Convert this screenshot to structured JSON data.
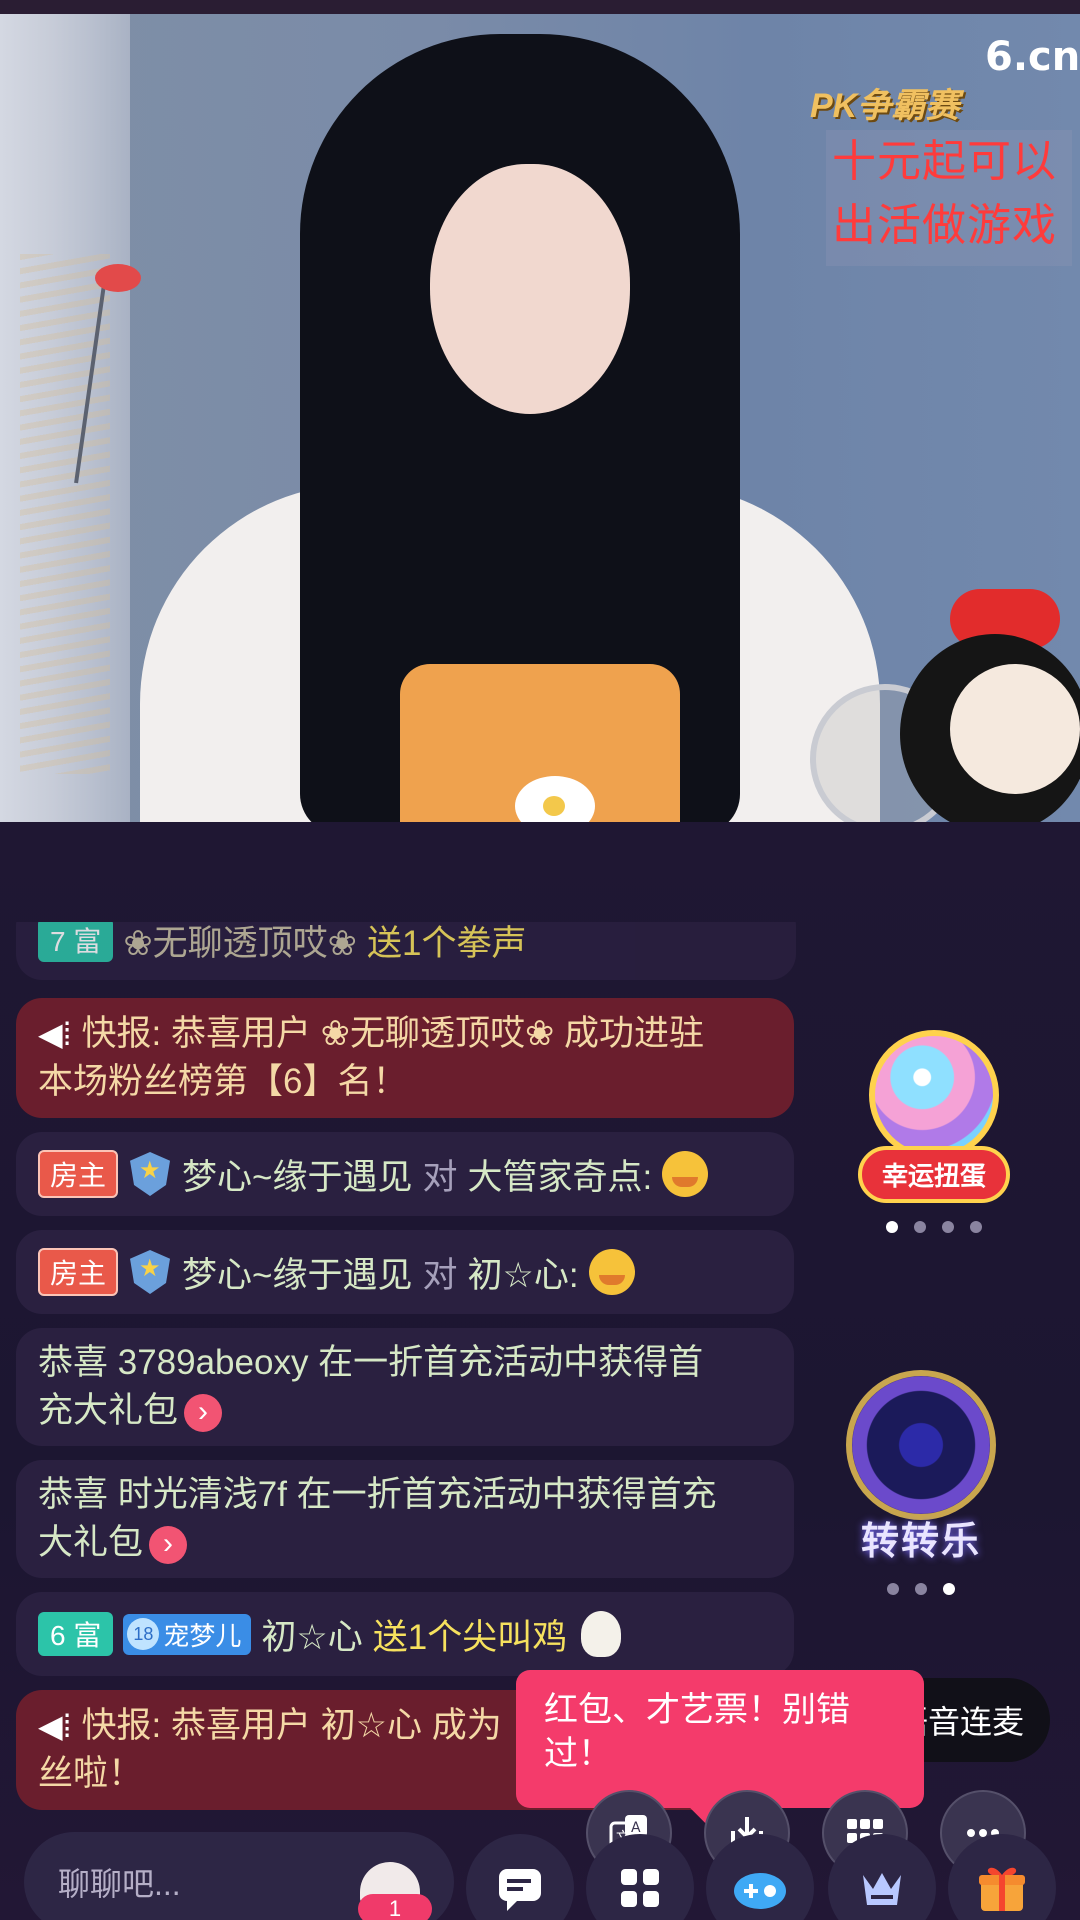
{
  "video": {
    "site_logo": "6.cn",
    "event_banner": "PK争霸赛",
    "promo_lines": [
      "十元起可以",
      "出活做游戏"
    ]
  },
  "chat": {
    "faded_message": {
      "level_tag": "7 富",
      "user": "❀无聊透顶哎❀",
      "text": "送1个拳声"
    },
    "messages": [
      {
        "type": "alert",
        "icon": "speaker-icon",
        "text_line1": "快报: 恭喜用户 ❀无聊透顶哎❀ 成功进驻",
        "text_line2": "本场粉丝榜第【6】名！"
      },
      {
        "type": "chat",
        "role_tag": "房主",
        "user": "梦心~缘于遇见",
        "connector": "对",
        "target": "大管家奇点:"
      },
      {
        "type": "chat",
        "role_tag": "房主",
        "user": "梦心~缘于遇见",
        "connector": "对",
        "target": "初☆心:"
      },
      {
        "type": "system",
        "text_line1": "恭喜 3789abeoxy 在一折首充活动中获得首",
        "text_line2": "充大礼包"
      },
      {
        "type": "system",
        "text_line1": "恭喜 时光清浅7f 在一折首充活动中获得首充",
        "text_line2": "大礼包"
      },
      {
        "type": "gift",
        "rich_tag": "6 富",
        "pet_level": "18",
        "pet_name": "宠梦儿",
        "user": "初☆心",
        "gift_text": "送1个尖叫鸡"
      },
      {
        "type": "alert",
        "icon": "speaker-icon",
        "text_line1": "快报: 恭喜用户 初☆心 成为",
        "text_line2": "丝啦！"
      }
    ]
  },
  "widgets": {
    "lucky_egg_label": "幸运扭蛋",
    "spin_label": "转转乐"
  },
  "voice_link": "语音连麦",
  "tooltip": "红包、才艺票！别错过！",
  "input": {
    "placeholder": "聊聊吧...",
    "badge_count": "1"
  },
  "icons": {
    "translate": "translate-icon",
    "download": "download-icon",
    "grid": "grid-icon",
    "more": "more-icon"
  },
  "colors": {
    "alert_bg": "#6a1e2d",
    "tooltip_bg": "#f43b6b",
    "chat_bg": "#1c1631"
  }
}
